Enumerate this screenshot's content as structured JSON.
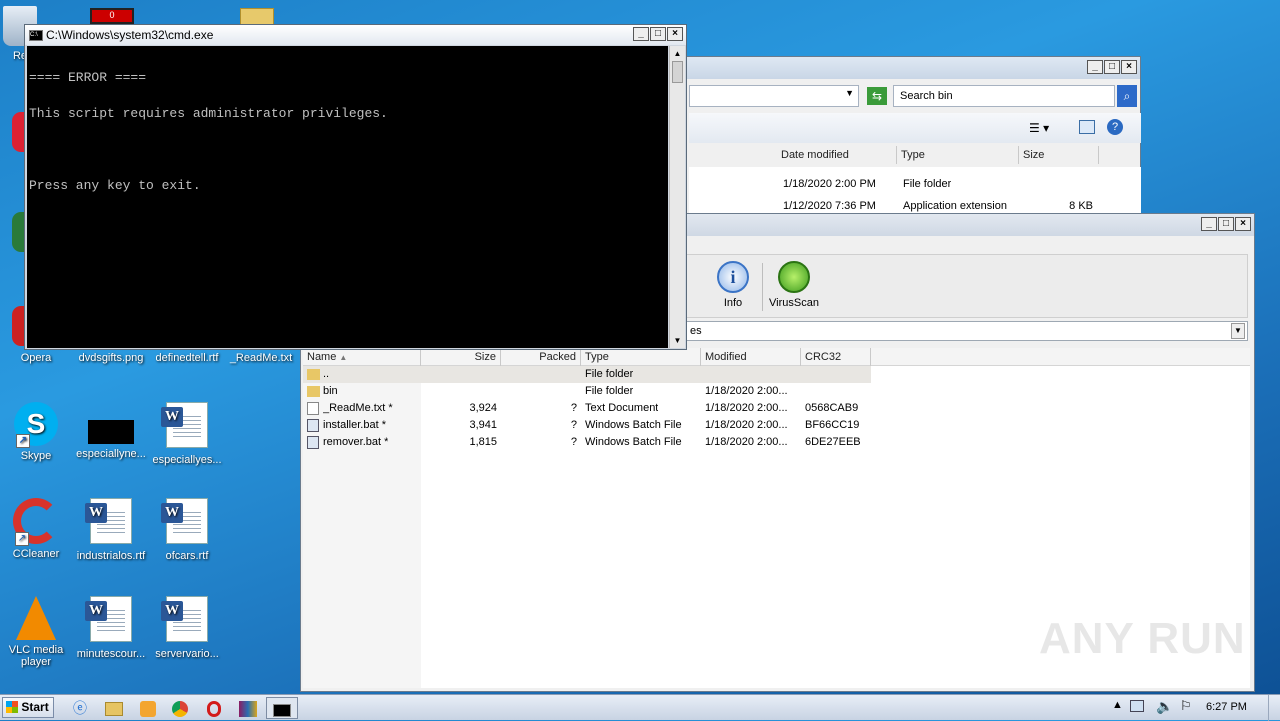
{
  "desktop": {
    "icons": [
      {
        "label": "Re",
        "name": "recycle-bin-icon"
      },
      {
        "label": "Opera",
        "name": "opera-icon"
      },
      {
        "label": "dvdsgifts.png",
        "name": "image-file-icon"
      },
      {
        "label": "definedtell.rtf",
        "name": "rtf-file-icon"
      },
      {
        "label": "_ReadMe.txt",
        "name": "txt-file-icon"
      },
      {
        "label": "Skype",
        "name": "skype-icon"
      },
      {
        "label": "especiallyne...",
        "name": "image-file-icon"
      },
      {
        "label": "especiallyes...",
        "name": "word-doc-icon"
      },
      {
        "label": "CCleaner",
        "name": "ccleaner-icon"
      },
      {
        "label": "industrialos.rtf",
        "name": "word-doc-icon"
      },
      {
        "label": "ofcars.rtf",
        "name": "word-doc-icon"
      },
      {
        "label": "VLC media player",
        "name": "vlc-icon"
      },
      {
        "label": "minutescour...",
        "name": "word-doc-icon"
      },
      {
        "label": "servervario...",
        "name": "word-doc-icon"
      }
    ]
  },
  "cmd": {
    "title": "C:\\Windows\\system32\\cmd.exe",
    "lines": [
      "==== ERROR ====",
      "This script requires administrator privileges.",
      "",
      "Press any key to exit."
    ]
  },
  "explorer": {
    "search_placeholder": "Search bin",
    "columns": {
      "date": "Date modified",
      "type": "Type",
      "size": "Size"
    },
    "rows": [
      {
        "date": "1/18/2020 2:00 PM",
        "type": "File folder",
        "size": ""
      },
      {
        "date": "1/12/2020 7:36 PM",
        "type": "Application extension",
        "size": "8 KB"
      }
    ]
  },
  "archiver": {
    "toolbar": {
      "info": "Info",
      "virusscan": "VirusScan"
    },
    "path": "es",
    "columns": {
      "name": "Name",
      "size": "Size",
      "packed": "Packed",
      "type": "Type",
      "modified": "Modified",
      "crc": "CRC32"
    },
    "rows": [
      {
        "name": "..",
        "size": "",
        "packed": "",
        "type": "File folder",
        "modified": "",
        "crc": ""
      },
      {
        "name": "bin",
        "size": "",
        "packed": "",
        "type": "File folder",
        "modified": "1/18/2020 2:00...",
        "crc": ""
      },
      {
        "name": "_ReadMe.txt *",
        "size": "3,924",
        "packed": "?",
        "type": "Text Document",
        "modified": "1/18/2020 2:00...",
        "crc": "0568CAB9"
      },
      {
        "name": "installer.bat *",
        "size": "3,941",
        "packed": "?",
        "type": "Windows Batch File",
        "modified": "1/18/2020 2:00...",
        "crc": "BF66CC19"
      },
      {
        "name": "remover.bat *",
        "size": "1,815",
        "packed": "?",
        "type": "Windows Batch File",
        "modified": "1/18/2020 2:00...",
        "crc": "6DE27EEB"
      }
    ]
  },
  "taskbar": {
    "start": "Start",
    "clock": "6:27 PM"
  },
  "watermark": "ANY RUN"
}
